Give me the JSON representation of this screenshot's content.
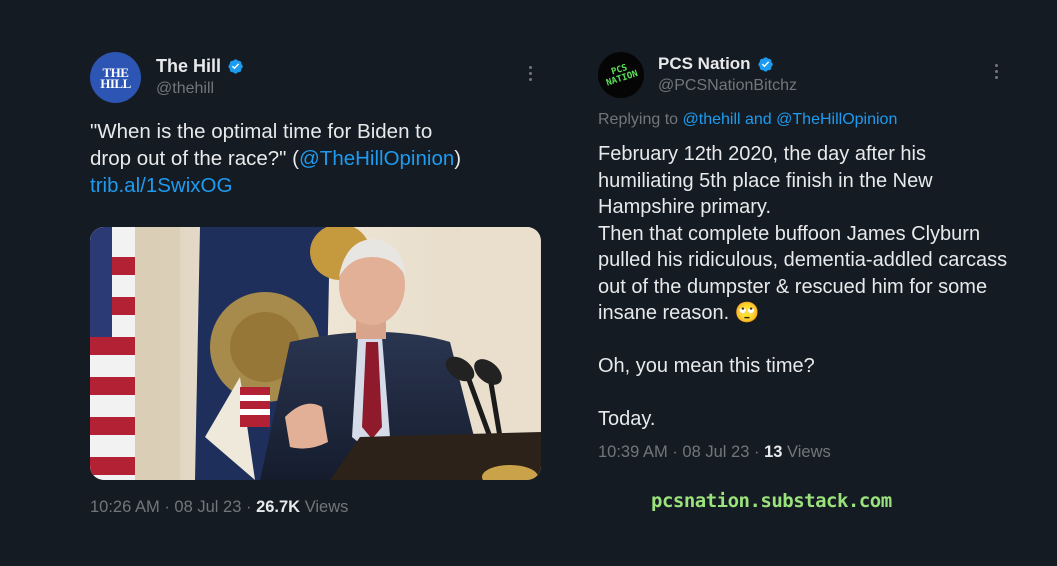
{
  "left_tweet": {
    "avatar_text_line1": "THE",
    "avatar_text_line2": "HILL",
    "display_name": "The Hill",
    "handle": "@thehill",
    "text_line1": "\"When is the optimal time for Biden to",
    "text_line2": "drop out of the race?\" (",
    "mention": "@TheHillOpinion",
    "text_line2_end": ")",
    "link": "trib.al/1SwixOG",
    "time": "10:26 AM",
    "date": "08 Jul 23",
    "views_count": "26.7K",
    "views_label": "Views",
    "separator": "·"
  },
  "right_tweet": {
    "avatar_text": "PCS NATION",
    "display_name": "PCS Nation",
    "handle": "@PCSNationBitchz",
    "replying_label": "Replying to",
    "reply_mention1": "@thehill",
    "reply_and": "and",
    "reply_mention2": "@TheHillOpinion",
    "text_para1": "February 12th 2020, the day after his humiliating 5th place finish in the New Hampshire primary.\nThen that complete buffoon James Clyburn pulled his ridiculous, dementia-addled carcass out of the dumpster & rescued him for some insane reason. 🙄",
    "text_para2": "Oh, you mean this time?",
    "text_para3": "Today.",
    "time": "10:39 AM",
    "date": "08 Jul 23",
    "views_count": "13",
    "views_label": "Views",
    "separator": "·"
  },
  "footer": {
    "url": "pcsnation.substack.com"
  },
  "icons": {
    "verified": "verified-badge-icon",
    "more": "more-dots-icon"
  },
  "colors": {
    "background": "#151b22",
    "text": "#e7e9ea",
    "muted": "#71767b",
    "link": "#1d9bf0",
    "verified": "#1d9bf0",
    "hill_avatar": "#2d55b4",
    "footer_text": "#9ae27c"
  }
}
